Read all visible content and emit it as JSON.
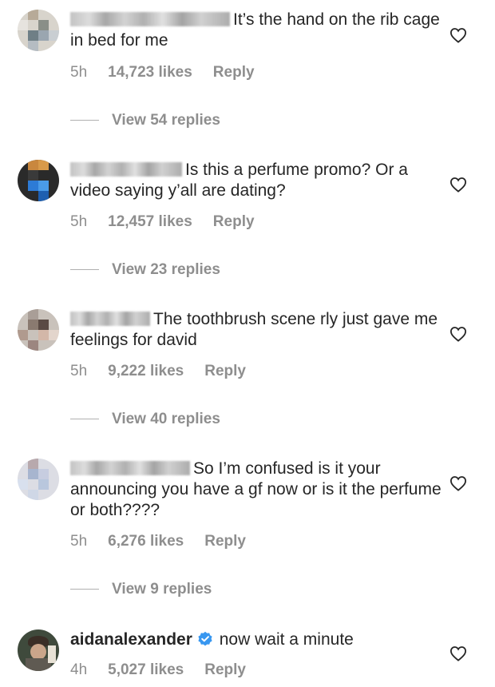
{
  "comments": [
    {
      "username_visible": "",
      "text": "It’s the hand on the rib cage in bed for me",
      "time": "5h",
      "likes": "14,723 likes",
      "reply": "Reply",
      "view_replies": "View 54 replies"
    },
    {
      "username_visible": "",
      "text": "Is this a perfume promo? Or a video saying y’all are dating?",
      "time": "5h",
      "likes": "12,457 likes",
      "reply": "Reply",
      "view_replies": "View 23 replies"
    },
    {
      "username_visible": "",
      "text": "The toothbrush scene rly just gave me feelings for david",
      "time": "5h",
      "likes": "9,222 likes",
      "reply": "Reply",
      "view_replies": "View 40 replies"
    },
    {
      "username_visible": "",
      "text": "So I’m confused is it your announcing you have a gf now or is it the perfume or both????",
      "time": "5h",
      "likes": "6,276 likes",
      "reply": "Reply",
      "view_replies": "View 9 replies"
    },
    {
      "username_visible": "aidanalexander",
      "verified": true,
      "text": "now wait a minute",
      "time": "4h",
      "likes": "5,027 likes",
      "reply": "Reply"
    }
  ],
  "colors": {
    "text": "#262626",
    "meta": "#8e8e8e",
    "verified": "#3897f0"
  },
  "icons": {
    "like": "heart-outline-icon",
    "verified": "verified-badge-icon"
  }
}
